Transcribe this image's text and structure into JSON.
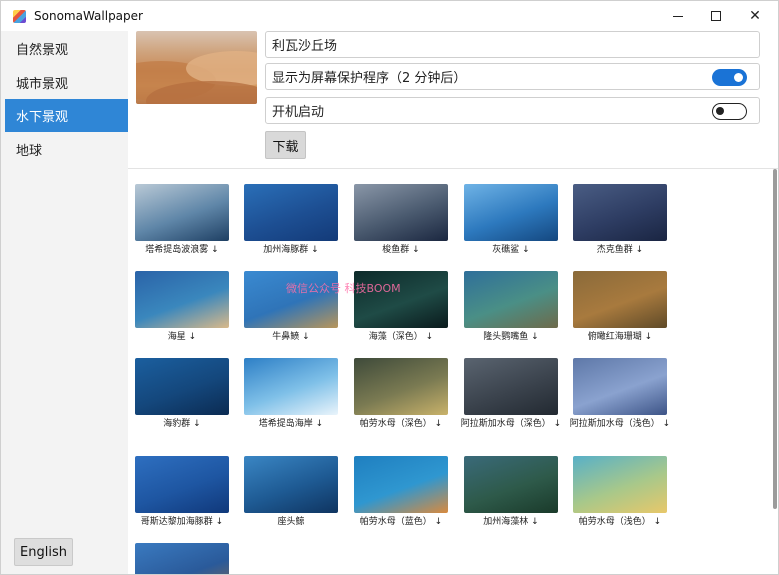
{
  "app": {
    "title": "SonomaWallpaper"
  },
  "window_controls": {
    "minimize": "",
    "maximize": "",
    "close": "✕"
  },
  "sidebar": {
    "items": [
      {
        "label": "自然景观"
      },
      {
        "label": "城市景观"
      },
      {
        "label": "水下景观",
        "active": true
      },
      {
        "label": "地球"
      }
    ],
    "language_button": "English"
  },
  "detail": {
    "name": "利瓦沙丘场",
    "screensaver_label": "显示为屏幕保护程序（2 分钟后）",
    "screensaver_on": true,
    "autostart_label": "开机启动",
    "autostart_on": false,
    "download_label": "下载"
  },
  "watermark": "微信公众号  科技BOOM",
  "gallery": {
    "items": [
      {
        "caption": "塔希提岛波浪雾 ↓",
        "colors": [
          "#b9c9d6",
          "#5f86a8",
          "#1e3f63"
        ]
      },
      {
        "caption": "加州海豚群 ↓",
        "colors": [
          "#2a6fb8",
          "#1d4f93",
          "#133a78"
        ]
      },
      {
        "caption": "梭鱼群 ↓",
        "colors": [
          "#8a97a8",
          "#4a5a6f",
          "#1b2740"
        ]
      },
      {
        "caption": "灰礁鲨 ↓",
        "colors": [
          "#6fb3e6",
          "#2d79be",
          "#14477f"
        ]
      },
      {
        "caption": "杰克鱼群 ↓",
        "colors": [
          "#4a5d84",
          "#2e3d63",
          "#1a2542"
        ]
      },
      {
        "caption": "海星 ↓",
        "colors": [
          "#2a63a8",
          "#3a87bd",
          "#d9b98a"
        ]
      },
      {
        "caption": "牛鼻鲼 ↓",
        "colors": [
          "#3a8ad1",
          "#2f74b8",
          "#b8955a"
        ]
      },
      {
        "caption": "海藻（深色） ↓",
        "colors": [
          "#0d2a2a",
          "#1f4b46",
          "#0a1a1c"
        ]
      },
      {
        "caption": "隆头鹦嘴鱼 ↓",
        "colors": [
          "#2f6f9a",
          "#4a8f86",
          "#6e6a4a"
        ]
      },
      {
        "caption": "俯瞰红海珊瑚 ↓",
        "colors": [
          "#8a6a3a",
          "#a87a3e",
          "#5f4a28"
        ]
      },
      {
        "caption": "海豹群 ↓",
        "colors": [
          "#1b5f9f",
          "#14477c",
          "#0b2b52"
        ]
      },
      {
        "caption": "塔希提岛海岸 ↓",
        "colors": [
          "#2d7fc6",
          "#7fc0e8",
          "#eaf4fb"
        ]
      },
      {
        "caption": "帕劳水母（深色） ↓",
        "colors": [
          "#3e4a3a",
          "#7a7a52",
          "#c9b26a"
        ]
      },
      {
        "caption": "阿拉斯加水母（深色） ↓",
        "colors": [
          "#5a6470",
          "#3b434d",
          "#222931"
        ]
      },
      {
        "caption": "阿拉斯加水母（浅色） ↓",
        "colors": [
          "#5e78a8",
          "#8aa2cf",
          "#3d5487"
        ]
      },
      {
        "caption": "哥斯达黎加海豚群 ↓",
        "colors": [
          "#2e6fc0",
          "#1e56a2",
          "#10387a"
        ]
      },
      {
        "caption": "座头鲸",
        "colors": [
          "#3a86c4",
          "#1e5a93",
          "#0f3460"
        ]
      },
      {
        "caption": "帕劳水母（蓝色） ↓",
        "colors": [
          "#1f7fc0",
          "#2f97d0",
          "#d98a3e"
        ]
      },
      {
        "caption": "加州海藻林 ↓",
        "colors": [
          "#3a6a7a",
          "#2e5a4a",
          "#1a3a2a"
        ]
      },
      {
        "caption": "帕劳水母（浅色） ↓",
        "colors": [
          "#58b0c8",
          "#a8c88a",
          "#e8c86a"
        ]
      },
      {
        "caption": "",
        "colors": [
          "#3a7ac0",
          "#2a5a9a",
          "#8a6a4a"
        ]
      }
    ]
  }
}
